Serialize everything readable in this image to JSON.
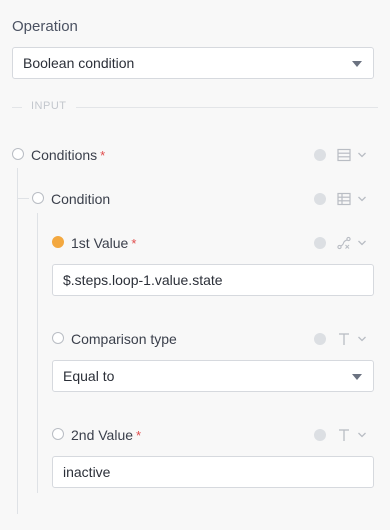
{
  "operation": {
    "label": "Operation",
    "selected": "Boolean condition"
  },
  "divider": "INPUT",
  "conditions": {
    "label": "Conditions",
    "required_mark": "*"
  },
  "condition": {
    "label": "Condition"
  },
  "first_value": {
    "label": "1st Value",
    "required_mark": "*",
    "value": "$.steps.loop-1.value.state"
  },
  "comparison": {
    "label": "Comparison type",
    "selected": "Equal to"
  },
  "second_value": {
    "label": "2nd Value",
    "required_mark": "*",
    "value": "inactive"
  },
  "colors": {
    "accent_filled_radio": "#f3a840",
    "required": "#e04b4b"
  },
  "icons": {
    "conditions_type": "list-icon",
    "condition_type": "object-list-icon",
    "first_value_type": "variable-icon",
    "text_type": "text-type-icon",
    "info": "info-dot-icon",
    "chevron": "chevron-down-icon"
  }
}
